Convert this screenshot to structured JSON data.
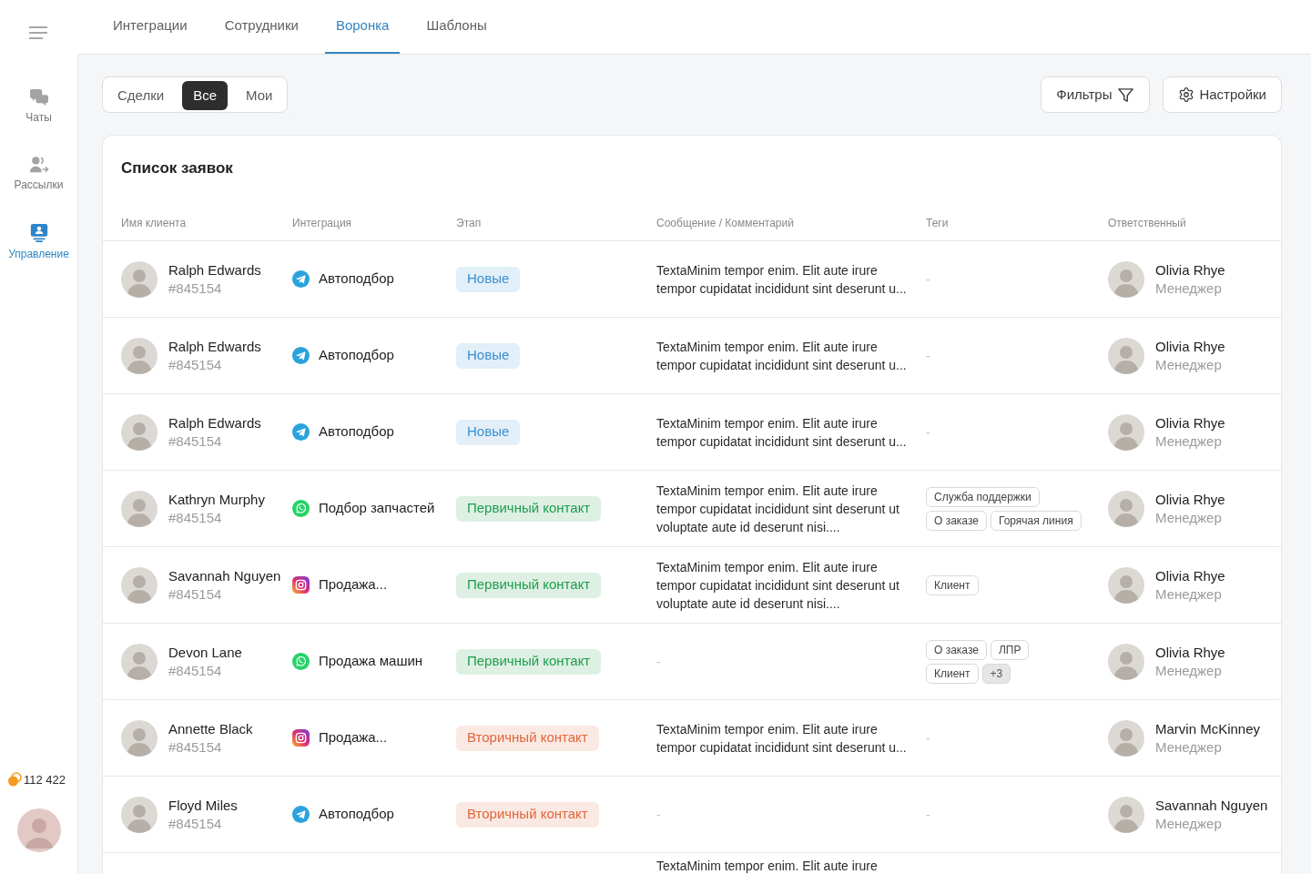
{
  "sidebar": {
    "items": [
      {
        "kind": "chats",
        "label": "Чаты",
        "selected": false
      },
      {
        "kind": "mailings",
        "label": "Рассылки",
        "selected": false
      },
      {
        "kind": "management",
        "label": "Управление",
        "selected": true
      }
    ],
    "balance": "112 422"
  },
  "tabs": [
    {
      "label": "Интеграции",
      "selected": false
    },
    {
      "label": "Сотрудники",
      "selected": false
    },
    {
      "label": "Воронка",
      "selected": true
    },
    {
      "label": "Шаблоны",
      "selected": false
    }
  ],
  "segments": [
    {
      "label": "Сделки",
      "selected": false
    },
    {
      "label": "Все",
      "selected": true
    },
    {
      "label": "Мои",
      "selected": false
    }
  ],
  "toolbar": {
    "filters": "Фильтры",
    "settings": "Настройки"
  },
  "table": {
    "title": "Список заявок",
    "columns": [
      "Имя клиента",
      "Интеграция",
      "Этап",
      "Сообщение / Комментарий",
      "Теги",
      "Ответственный"
    ],
    "rows": [
      {
        "client": {
          "name": "Ralph Edwards",
          "id": "#845154"
        },
        "integration": {
          "kind": "telegram",
          "name": "Автоподбор"
        },
        "stage": {
          "label": "Новые",
          "color": "#3a8fd0"
        },
        "message": {
          "kind": "text",
          "text": "TextaMinim tempor enim. Elit aute irure\ntempor cupidatat incididunt sint deserunt u..."
        },
        "tags": {
          "kind": "empty",
          "text": "-"
        },
        "manager": {
          "name": "Olivia Rhye",
          "role": "Менеджер"
        }
      },
      {
        "client": {
          "name": "Ralph Edwards",
          "id": "#845154"
        },
        "integration": {
          "kind": "telegram",
          "name": "Автоподбор"
        },
        "stage": {
          "label": "Новые",
          "color": "#3a8fd0"
        },
        "message": {
          "kind": "text",
          "text": "TextaMinim tempor enim. Elit aute irure\ntempor cupidatat incididunt sint deserunt u..."
        },
        "tags": {
          "kind": "empty",
          "text": "-"
        },
        "manager": {
          "name": "Olivia Rhye",
          "role": "Менеджер"
        }
      },
      {
        "client": {
          "name": "Ralph Edwards",
          "id": "#845154"
        },
        "integration": {
          "kind": "telegram",
          "name": "Автоподбор"
        },
        "stage": {
          "label": "Новые",
          "color": "#3a8fd0"
        },
        "message": {
          "kind": "text",
          "text": "TextaMinim tempor enim. Elit aute irure\ntempor cupidatat incididunt sint deserunt u..."
        },
        "tags": {
          "kind": "empty",
          "text": "-"
        },
        "manager": {
          "name": "Olivia Rhye",
          "role": "Менеджер"
        }
      },
      {
        "client": {
          "name": "Kathryn Murphy",
          "id": "#845154"
        },
        "integration": {
          "kind": "whatsapp",
          "name": "Подбор запчастей"
        },
        "stage": {
          "label": "Первичный контакт",
          "color": "#1f9d4c"
        },
        "message": {
          "kind": "text",
          "text": "TextaMinim tempor enim. Elit aute irure\ntempor cupidatat incididunt sint deserunt ut\nvoluptate aute id deserunt nisi...."
        },
        "tags": {
          "kind": "list",
          "lines": [
            [
              {
                "kind": "tag",
                "label": "Служба поддержки"
              }
            ],
            [
              {
                "kind": "tag",
                "label": "О заказе"
              },
              {
                "kind": "tag",
                "label": "Горячая линия"
              }
            ]
          ]
        },
        "manager": {
          "name": "Olivia Rhye",
          "role": "Менеджер"
        }
      },
      {
        "client": {
          "name": "Savannah Nguyen",
          "id": "#845154"
        },
        "integration": {
          "kind": "instagram",
          "name": "Продажа..."
        },
        "stage": {
          "label": "Первичный контакт",
          "color": "#1f9d4c"
        },
        "message": {
          "kind": "text",
          "text": "TextaMinim tempor enim. Elit aute irure\ntempor cupidatat incididunt sint deserunt ut\nvoluptate aute id deserunt nisi...."
        },
        "tags": {
          "kind": "list",
          "lines": [
            [
              {
                "kind": "tag",
                "label": "Клиент"
              }
            ]
          ]
        },
        "manager": {
          "name": "Olivia Rhye",
          "role": "Менеджер"
        }
      },
      {
        "client": {
          "name": "Devon Lane",
          "id": "#845154"
        },
        "integration": {
          "kind": "whatsapp",
          "name": "Продажа машин"
        },
        "stage": {
          "label": "Первичный контакт",
          "color": "#1f9d4c"
        },
        "message": {
          "kind": "empty",
          "text": "-"
        },
        "tags": {
          "kind": "list",
          "lines": [
            [
              {
                "kind": "tag",
                "label": "О заказе"
              },
              {
                "kind": "tag",
                "label": "ЛПР"
              }
            ],
            [
              {
                "kind": "tag",
                "label": "Клиент"
              },
              {
                "kind": "more",
                "label": "+3"
              }
            ]
          ]
        },
        "manager": {
          "name": "Olivia Rhye",
          "role": "Менеджер"
        }
      },
      {
        "client": {
          "name": "Annette Black",
          "id": "#845154"
        },
        "integration": {
          "kind": "instagram",
          "name": "Продажа..."
        },
        "stage": {
          "label": "Вторичный контакт",
          "color": "#e0673b"
        },
        "message": {
          "kind": "text",
          "text": "TextaMinim tempor enim. Elit aute irure\ntempor cupidatat incididunt sint deserunt u..."
        },
        "tags": {
          "kind": "empty",
          "text": "-"
        },
        "manager": {
          "name": "Marvin McKinney",
          "role": "Менеджер"
        }
      },
      {
        "client": {
          "name": "Floyd Miles",
          "id": "#845154"
        },
        "integration": {
          "kind": "telegram",
          "name": "Автоподбор"
        },
        "stage": {
          "label": "Вторичный контакт",
          "color": "#e0673b"
        },
        "message": {
          "kind": "empty",
          "text": "-"
        },
        "tags": {
          "kind": "empty",
          "text": "-"
        },
        "manager": {
          "name": "Savannah Nguyen",
          "role": "Менеджер"
        }
      },
      {
        "message": {
          "kind": "text",
          "text": "TextaMinim tempor enim. Elit aute irure"
        }
      }
    ]
  }
}
